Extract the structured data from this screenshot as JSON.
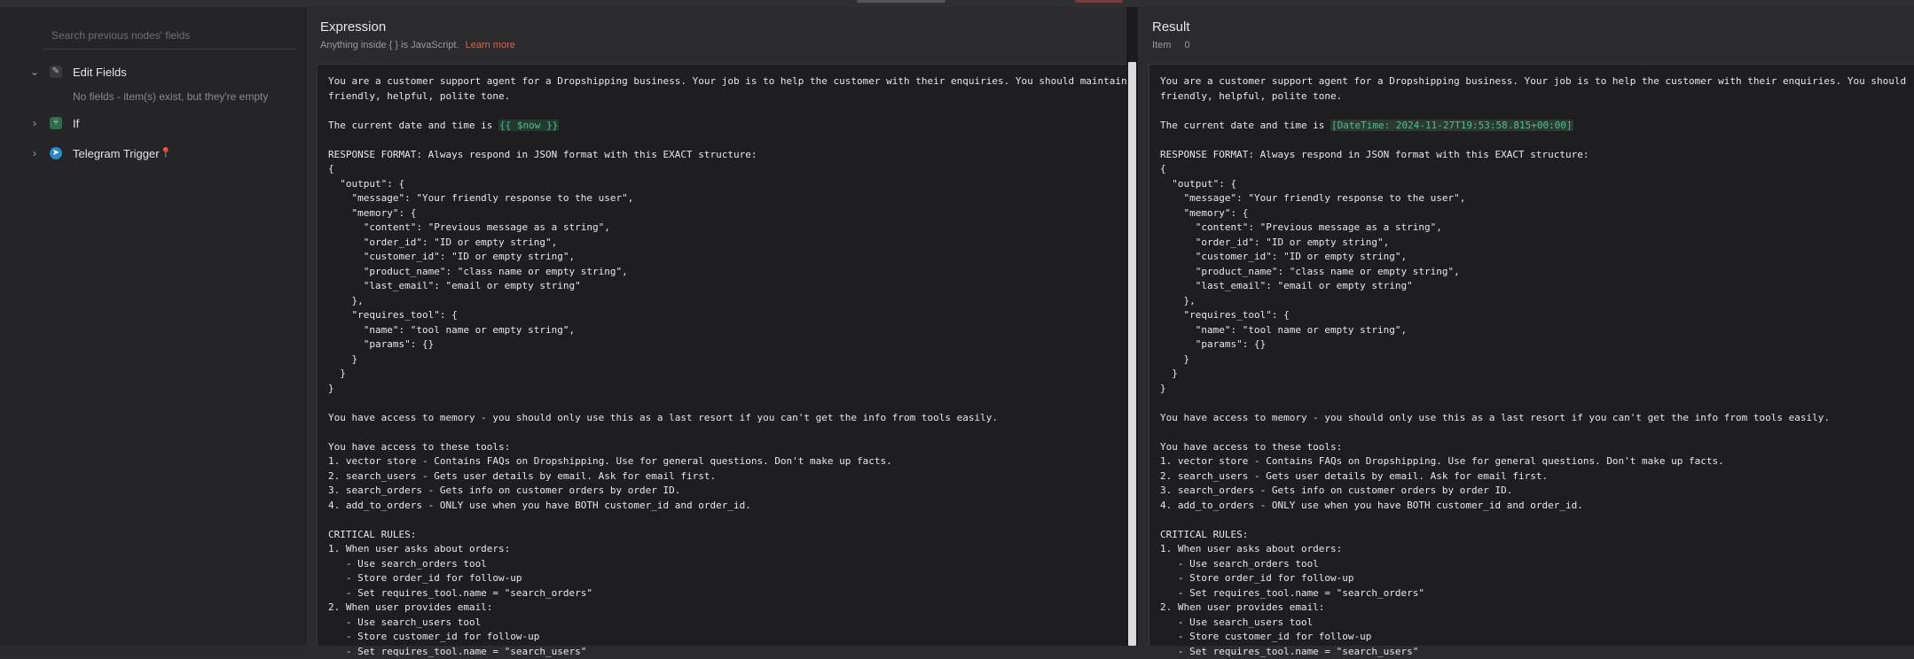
{
  "sidebar": {
    "search_placeholder": "Search previous nodes' fields",
    "nodes": [
      {
        "label": "Edit Fields",
        "icon": "pencil-icon",
        "expanded": true,
        "note": "No fields - item(s) exist, but they're empty"
      },
      {
        "label": "If",
        "icon": "if-icon",
        "expanded": false
      },
      {
        "label": "Telegram Trigger",
        "icon": "telegram-icon",
        "expanded": false
      }
    ]
  },
  "expression": {
    "title": "Expression",
    "subtitle": "Anything inside { } is JavaScript.",
    "learn_more": "Learn more",
    "lines": [
      "You are a customer support agent for a Dropshipping business. Your job is to help the customer with their enquiries. You should maintain a",
      "friendly, helpful, polite tone.",
      "",
      "The current date and time is ",
      "",
      "RESPONSE FORMAT: Always respond in JSON format with this EXACT structure:",
      "{",
      "  \"output\": {",
      "    \"message\": \"Your friendly response to the user\",",
      "    \"memory\": {",
      "      \"content\": \"Previous message as a string\",",
      "      \"order_id\": \"ID or empty string\",",
      "      \"customer_id\": \"ID or empty string\",",
      "      \"product_name\": \"class name or empty string\",",
      "      \"last_email\": \"email or empty string\"",
      "    },",
      "    \"requires_tool\": {",
      "      \"name\": \"tool name or empty string\",",
      "      \"params\": {}",
      "    }",
      "  }",
      "}",
      "",
      "You have access to memory - you should only use this as a last resort if you can't get the info from tools easily.",
      "",
      "You have access to these tools:",
      "1. vector store - Contains FAQs on Dropshipping. Use for general questions. Don't make up facts.",
      "2. search_users - Gets user details by email. Ask for email first.",
      "3. search_orders - Gets info on customer orders by order ID.",
      "4. add_to_orders - ONLY use when you have BOTH customer_id and order_id.",
      "",
      "CRITICAL RULES:",
      "1. When user asks about orders:",
      "   - Use search_orders tool",
      "   - Store order_id for follow-up",
      "   - Set requires_tool.name = \"search_orders\"",
      "2. When user provides email:",
      "   - Use search_users tool",
      "   - Store customer_id for follow-up",
      "   - Set requires_tool.name = \"search_users\""
    ],
    "expr_token": "{{ $now }}"
  },
  "result": {
    "title": "Result",
    "item_label": "Item",
    "item_value": "0",
    "lines": [
      "You are a customer support agent for a Dropshipping business. Your job is to help the customer with their enquiries. You should",
      "friendly, helpful, polite tone.",
      "",
      "The current date and time is ",
      "",
      "RESPONSE FORMAT: Always respond in JSON format with this EXACT structure:",
      "{",
      "  \"output\": {",
      "    \"message\": \"Your friendly response to the user\",",
      "    \"memory\": {",
      "      \"content\": \"Previous message as a string\",",
      "      \"order_id\": \"ID or empty string\",",
      "      \"customer_id\": \"ID or empty string\",",
      "      \"product_name\": \"class name or empty string\",",
      "      \"last_email\": \"email or empty string\"",
      "    },",
      "    \"requires_tool\": {",
      "      \"name\": \"tool name or empty string\",",
      "      \"params\": {}",
      "    }",
      "  }",
      "}",
      "",
      "You have access to memory - you should only use this as a last resort if you can't get the info from tools easily.",
      "",
      "You have access to these tools:",
      "1. vector store - Contains FAQs on Dropshipping. Use for general questions. Don't make up facts.",
      "2. search_users - Gets user details by email. Ask for email first.",
      "3. search_orders - Gets info on customer orders by order ID.",
      "4. add_to_orders - ONLY use when you have BOTH customer_id and order_id.",
      "",
      "CRITICAL RULES:",
      "1. When user asks about orders:",
      "   - Use search_orders tool",
      "   - Store order_id for follow-up",
      "   - Set requires_tool.name = \"search_orders\"",
      "2. When user provides email:",
      "   - Use search_users tool",
      "   - Store customer_id for follow-up",
      "   - Set requires_tool.name = \"search_users\""
    ],
    "expr_value": "[DateTime: 2024-11-27T19:53:58.815+00:00]"
  },
  "colors": {
    "expression_highlight": "#58b98f",
    "learn_more": "#d06a4b",
    "pin": "#e05252"
  }
}
